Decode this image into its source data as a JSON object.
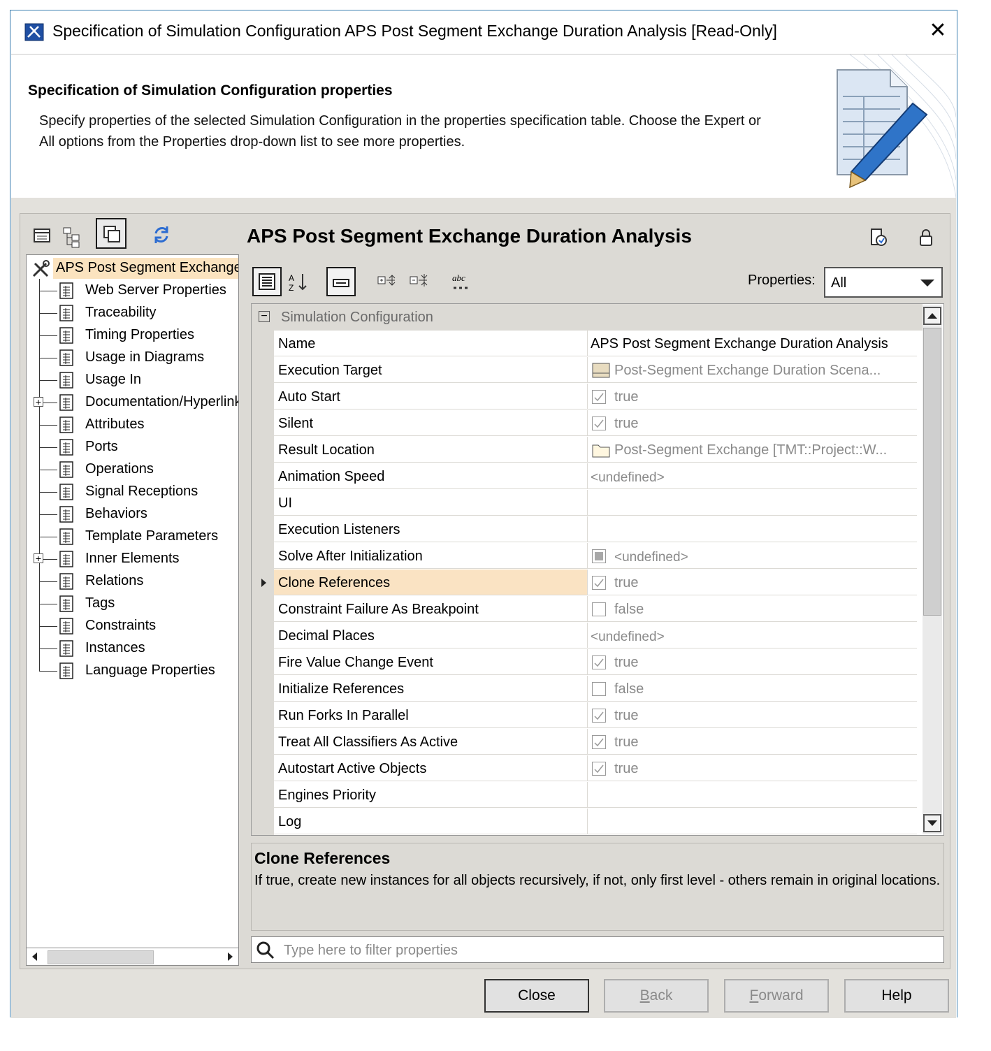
{
  "window": {
    "title": "Specification of Simulation Configuration APS Post Segment Exchange Duration Analysis [Read-Only]",
    "close_glyph": "✕"
  },
  "banner": {
    "title": "Specification of Simulation Configuration properties",
    "description": "Specify properties of the selected Simulation Configuration in the properties specification table. Choose the Expert or All options from the Properties drop-down list to see more properties."
  },
  "tree": {
    "root": "APS Post Segment Exchange Duration Analysis",
    "items": [
      {
        "label": "Web Server Properties",
        "expandable": false
      },
      {
        "label": "Traceability",
        "expandable": false
      },
      {
        "label": "Timing Properties",
        "expandable": false
      },
      {
        "label": "Usage in Diagrams",
        "expandable": false
      },
      {
        "label": "Usage In",
        "expandable": false
      },
      {
        "label": "Documentation/Hyperlinks",
        "expandable": true
      },
      {
        "label": "Attributes",
        "expandable": false
      },
      {
        "label": "Ports",
        "expandable": false
      },
      {
        "label": "Operations",
        "expandable": false
      },
      {
        "label": "Signal Receptions",
        "expandable": false
      },
      {
        "label": "Behaviors",
        "expandable": false
      },
      {
        "label": "Template Parameters",
        "expandable": false
      },
      {
        "label": "Inner Elements",
        "expandable": true
      },
      {
        "label": "Relations",
        "expandable": false
      },
      {
        "label": "Tags",
        "expandable": false
      },
      {
        "label": "Constraints",
        "expandable": false
      },
      {
        "label": "Instances",
        "expandable": false
      },
      {
        "label": "Language Properties",
        "expandable": false
      }
    ]
  },
  "main": {
    "title": "APS Post Segment Exchange Duration Analysis",
    "properties_label": "Properties:",
    "properties_value": "All",
    "group_label": "Simulation Configuration",
    "rows": [
      {
        "name": "Name",
        "value": "APS Post Segment Exchange Duration Analysis",
        "kind": "text"
      },
      {
        "name": "Execution Target",
        "value": "Post-Segment Exchange Duration Scena...",
        "kind": "element"
      },
      {
        "name": "Auto Start",
        "value": "true",
        "kind": "bool-true"
      },
      {
        "name": "Silent",
        "value": "true",
        "kind": "bool-true"
      },
      {
        "name": "Result Location",
        "value": "Post-Segment Exchange [TMT::Project::W...",
        "kind": "folder"
      },
      {
        "name": "Animation Speed",
        "value": "<undefined>",
        "kind": "undefined"
      },
      {
        "name": "UI",
        "value": "",
        "kind": "text"
      },
      {
        "name": "Execution Listeners",
        "value": "",
        "kind": "text"
      },
      {
        "name": "Solve After Initialization",
        "value": "<undefined>",
        "kind": "bool-undef"
      },
      {
        "name": "Clone References",
        "value": "true",
        "kind": "bool-true",
        "selected": true
      },
      {
        "name": "Constraint Failure As Breakpoint",
        "value": "false",
        "kind": "bool-false"
      },
      {
        "name": "Decimal Places",
        "value": "<undefined>",
        "kind": "undefined"
      },
      {
        "name": "Fire Value Change Event",
        "value": "true",
        "kind": "bool-true"
      },
      {
        "name": "Initialize References",
        "value": "false",
        "kind": "bool-false"
      },
      {
        "name": "Run Forks In Parallel",
        "value": "true",
        "kind": "bool-true"
      },
      {
        "name": "Treat All Classifiers As Active",
        "value": "true",
        "kind": "bool-true"
      },
      {
        "name": "Autostart Active Objects",
        "value": "true",
        "kind": "bool-true"
      },
      {
        "name": "Engines Priority",
        "value": "",
        "kind": "text"
      },
      {
        "name": "Log",
        "value": "",
        "kind": "text"
      }
    ],
    "description_title": "Clone References",
    "description_body": "If true, create new instances for all objects recursively, if not, only first level - others remain in original locations.",
    "filter_placeholder": "Type here to filter properties"
  },
  "buttons": {
    "close": "Close",
    "back_prefix": "B",
    "back_rest": "ack",
    "forward_prefix": "F",
    "forward_rest": "orward",
    "help": "Help"
  },
  "colors": {
    "selection": "#fae3c3",
    "panel_bg": "#dcdad5",
    "window_border": "#3c7fb1"
  }
}
